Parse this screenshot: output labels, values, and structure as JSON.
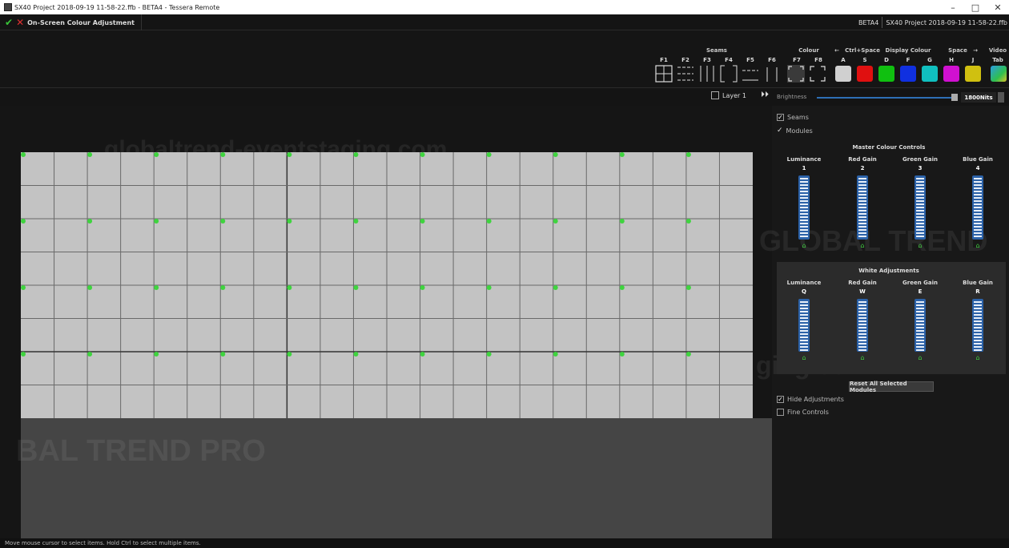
{
  "window": {
    "title": "SX40 Project 2018-09-19 11-58-22.ffb - BETA4 - Tessera Remote",
    "minimize": "–",
    "restore": "□",
    "close": "✕"
  },
  "cmdbar": {
    "mode": "On-Screen Colour Adjustment",
    "device": "BETA4",
    "project": "SX40 Project 2018-09-19 11-58-22.ffb"
  },
  "toolbar": {
    "seams_title": "Seams",
    "colour_title": "Colour",
    "ctrl_space": "Ctrl+Space",
    "display_colour": "Display Colour",
    "space": "Space",
    "video_title": "Video",
    "tab_label": "Tab",
    "fkeys": [
      "F1",
      "F2",
      "F3",
      "F4",
      "F5",
      "F6",
      "F7",
      "F8"
    ],
    "color_keys": [
      "A",
      "S",
      "D",
      "F",
      "G",
      "H",
      "J"
    ],
    "colors": [
      "#d0d0d0",
      "#e01010",
      "#10c010",
      "#1030e0",
      "#10c0c0",
      "#d010d0",
      "#d0c010"
    ]
  },
  "subbar": {
    "layer": "Layer 1",
    "brightness_label": "Brightness",
    "brightness_fraction": 0.98,
    "nits": "1800Nits"
  },
  "options": {
    "seams": "Seams",
    "modules": "Modules",
    "hide_adjustments": "Hide Adjustments",
    "fine_controls": "Fine Controls"
  },
  "master": {
    "title": "Master Colour Controls",
    "channels": [
      {
        "label": "Luminance",
        "key": "1"
      },
      {
        "label": "Red Gain",
        "key": "2"
      },
      {
        "label": "Green Gain",
        "key": "3"
      },
      {
        "label": "Blue Gain",
        "key": "4"
      }
    ]
  },
  "white": {
    "title": "White Adjustments",
    "channels": [
      {
        "label": "Luminance",
        "key": "Q"
      },
      {
        "label": "Red Gain",
        "key": "W"
      },
      {
        "label": "Green Gain",
        "key": "E"
      },
      {
        "label": "Blue Gain",
        "key": "R"
      }
    ]
  },
  "reset_button": "Reset All Selected Modules",
  "status": "Move mouse cursor to select items. Hold Ctrl to select multiple items.",
  "watermarks": [
    "globaltrend-eventstaging.com",
    "GLOBAL TREND",
    "BAL TREND PRO",
    "ging.com"
  ],
  "grid": {
    "cols": 22,
    "rows": 8,
    "marker_color": "#3fd43f"
  }
}
